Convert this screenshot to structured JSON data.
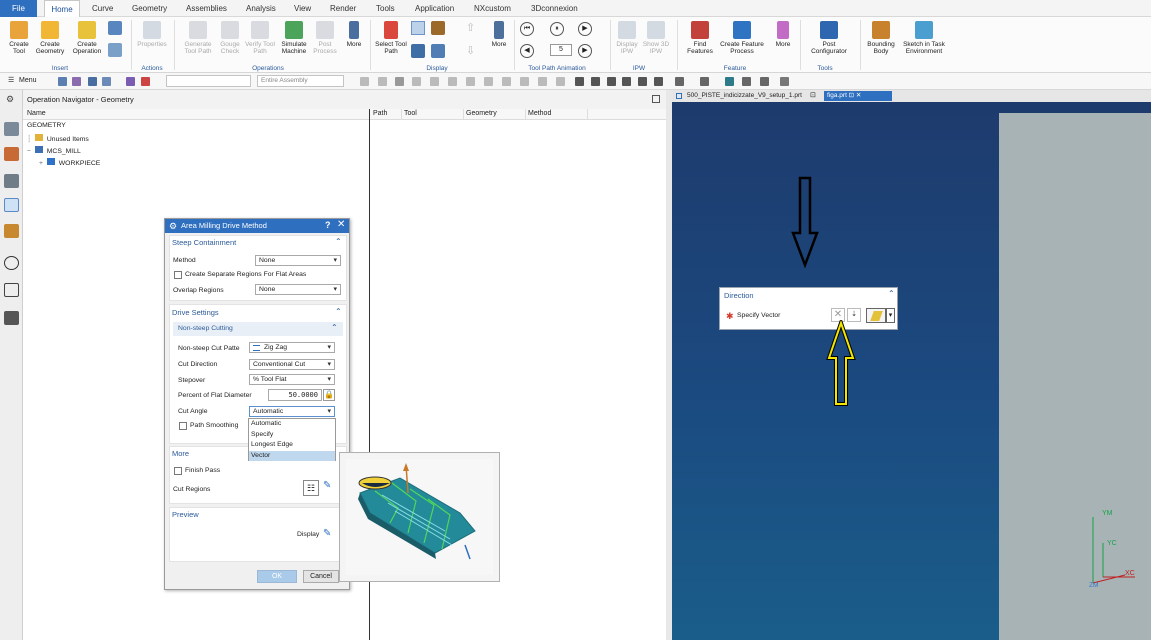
{
  "tabs": [
    "File",
    "Home",
    "Curve",
    "Geometry",
    "Assemblies",
    "Analysis",
    "View",
    "Render",
    "Tools",
    "Application",
    "NXcustom",
    "3Dconnexion"
  ],
  "ribbon": {
    "create_tool": "Create Tool",
    "create_geometry": "Create Geometry",
    "create_operation": "Create Operation",
    "properties": "Properties",
    "generate_tool_path": "Generate Tool Path",
    "gouge_check": "Gouge Check",
    "verify_tool_path": "Verify Tool Path",
    "simulate_machine": "Simulate Machine",
    "post_process": "Post Process",
    "more": "More",
    "select_tool_path": "Select Tool Path",
    "display_ipw": "Display IPW",
    "show_3d_ipw": "Show 3D IPW",
    "find_features": "Find Features",
    "create_feature_process": "Create Feature Process",
    "post_configurator": "Post Configurator",
    "bounding_body": "Bounding Body",
    "sketch_in_task": "Sketch in Task Environment",
    "groups": {
      "insert": "Insert",
      "actions": "Actions",
      "operations": "Operations",
      "display": "Display",
      "animation": "Tool Path Animation",
      "ipw": "IPW",
      "feature": "Feature",
      "tools": "Tools"
    },
    "anim_field": "5"
  },
  "quickbar": {
    "menu": "Menu",
    "filter_placeholder": "",
    "assembly_scope": "Entire Assembly"
  },
  "navigator": {
    "title": "Operation Navigator - Geometry",
    "columns": [
      "Name",
      "Path",
      "Tool",
      "Geometry",
      "Method"
    ],
    "tree": [
      "GEOMETRY",
      "Unused Items",
      "MCS_MILL",
      "WORKPIECE"
    ]
  },
  "graphics_tabs": [
    "500_PISTE_indicizzate_V9_setup_1.prt",
    "figa.prt"
  ],
  "triad": {
    "ym": "YM",
    "yc": "YC",
    "xc": "XC",
    "zm": "ZM"
  },
  "dialog": {
    "title": "Area Milling Drive Method",
    "steep": {
      "header": "Steep Containment",
      "method_label": "Method",
      "method_value": "None",
      "separate_regions": "Create Separate Regions For Flat Areas",
      "overlap_label": "Overlap Regions",
      "overlap_value": "None"
    },
    "drive": {
      "header": "Drive Settings",
      "sub_header": "Non-steep Cutting",
      "pattern_label": "Non-steep Cut Patte",
      "pattern_value": "Zig Zag",
      "direction_label": "Cut Direction",
      "direction_value": "Conventional Cut",
      "stepover_label": "Stepover",
      "stepover_value": "% Tool Flat",
      "percent_label": "Percent of Flat Diameter",
      "percent_value": "50.0000",
      "angle_label": "Cut Angle",
      "angle_value": "Automatic",
      "smoothing": "Path Smoothing",
      "angle_options": [
        "Automatic",
        "Specify",
        "Longest Edge",
        "Vector"
      ]
    },
    "more": {
      "header": "More",
      "finish_pass": "Finish Pass",
      "cut_regions": "Cut Regions"
    },
    "preview": {
      "header": "Preview",
      "display": "Display"
    },
    "ok": "OK",
    "cancel": "Cancel"
  },
  "direction_dialog": {
    "title": "Direction",
    "specify_vector": "Specify Vector"
  },
  "colors": {
    "accent": "#2f6fbf",
    "highlight": "#bfd8ee",
    "arrow_yellow": "#f2e600"
  }
}
